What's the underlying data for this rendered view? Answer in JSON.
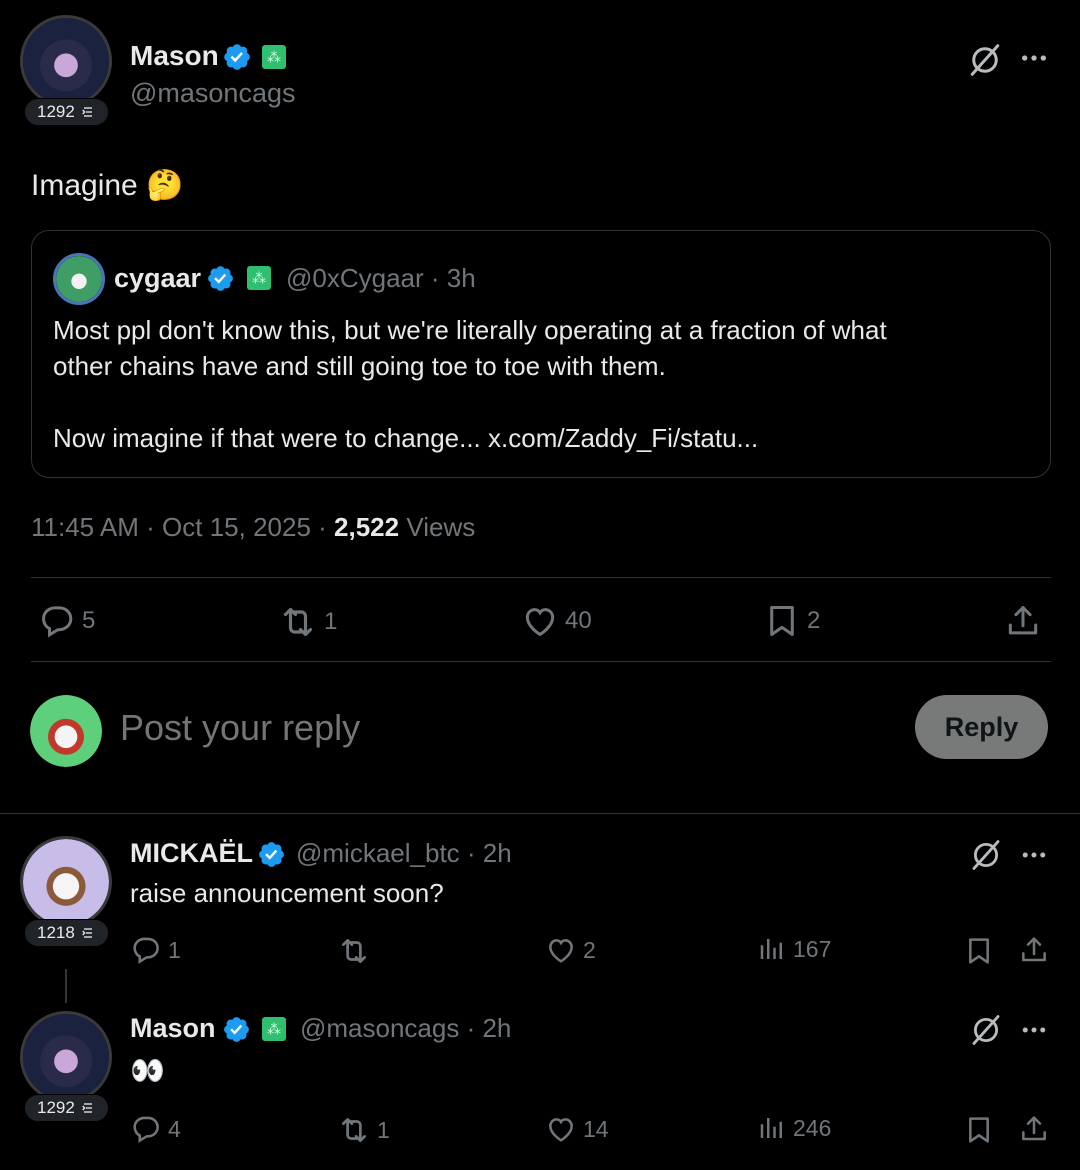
{
  "main_post": {
    "author_name": "Mason",
    "handle": "@masoncags",
    "score": "1292",
    "text": "Imagine",
    "emoji": "🤔",
    "timestamp": "11:45 AM · Oct 15, 2025 ·",
    "views_count": "2,522",
    "views_label": "Views",
    "stats": {
      "replies": "5",
      "reposts": "1",
      "likes": "40",
      "bookmarks": "2"
    }
  },
  "quoted_post": {
    "author_name": "cygaar",
    "handle": "@0xCygaar",
    "age": "· 3h",
    "line1": "Most ppl don't know this, but we're literally operating at a fraction of what",
    "line2": "other chains have and still going toe to toe with them.",
    "line3": "Now imagine if that were to change... x.com/Zaddy_Fi/statu..."
  },
  "composer": {
    "placeholder": "Post your reply",
    "reply_label": "Reply"
  },
  "replies": [
    {
      "author_name": "MICKAËL",
      "handle": "@mickael_btc",
      "age": "· 2h",
      "score": "1218",
      "text": "raise announcement soon?",
      "stats": {
        "replies": "1",
        "reposts": "",
        "likes": "2",
        "views": "167"
      }
    },
    {
      "author_name": "Mason",
      "handle": "@masoncags",
      "age": "· 2h",
      "score": "1292",
      "text": "👀",
      "stats": {
        "replies": "4",
        "reposts": "1",
        "likes": "14",
        "views": "246"
      }
    }
  ],
  "colors": {
    "background": "#000000",
    "verified": "#1d9bf0",
    "affiliate_badge": "#2fbf71",
    "muted_text": "#71767b"
  }
}
